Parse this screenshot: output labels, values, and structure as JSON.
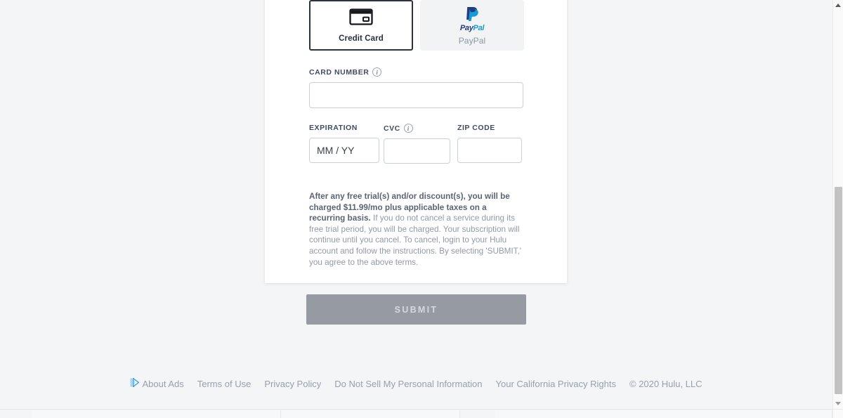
{
  "payment": {
    "tabs": [
      {
        "id": "credit-card",
        "label": "Credit Card",
        "icon": "credit-card-icon",
        "selected": true
      },
      {
        "id": "paypal",
        "label": "PayPal",
        "icon": "paypal-logo-icon",
        "selected": false
      }
    ],
    "paypal_logo": {
      "pay": "Pay",
      "pal": "Pal"
    }
  },
  "fields": {
    "card_number": {
      "label": "CARD NUMBER",
      "value": "",
      "placeholder": "",
      "has_info": true,
      "info_glyph": "i"
    },
    "expiration": {
      "label": "EXPIRATION",
      "value": "",
      "placeholder": "MM / YY",
      "has_info": false
    },
    "cvc": {
      "label": "CVC",
      "value": "",
      "placeholder": "",
      "has_info": true,
      "info_glyph": "i"
    },
    "zip_code": {
      "label": "ZIP CODE",
      "value": "",
      "placeholder": "",
      "has_info": false
    }
  },
  "legal": {
    "bold": "After any free trial(s) and/or discount(s), you will be charged $11.99/mo plus applicable taxes on a recurring basis.",
    "rest": " If you do not cancel a service during its free trial period, you will be charged. Your subscription will continue until you cancel. To cancel, login to your Hulu account and follow the instructions. By selecting 'SUBMIT,' you agree to the above terms.",
    "price": "$11.99/mo"
  },
  "submit": {
    "label": "SUBMIT",
    "disabled": true,
    "color": "#969aa2"
  },
  "footer": {
    "adchoices_icon": "adchoices-icon",
    "links": [
      "About Ads",
      "Terms of Use",
      "Privacy Policy",
      "Do Not Sell My Personal Information",
      "Your California Privacy Rights"
    ],
    "copyright": "© 2020 Hulu, LLC"
  },
  "colors": {
    "page_background": "#f4f5f7",
    "card_background": "#ffffff",
    "label": "#3d4c63",
    "input_border": "#c9d0dc",
    "legal_text": "#9199a8",
    "legal_bold": "#5a6475",
    "submit_bg": "#969aa2",
    "footer_text": "#99a0ac",
    "paypal_dark": "#253b80",
    "paypal_light": "#179bd7",
    "tab_selected_border": "#2d3240"
  },
  "scrollbar": {
    "vertical_present": true,
    "horizontal_present": true
  }
}
